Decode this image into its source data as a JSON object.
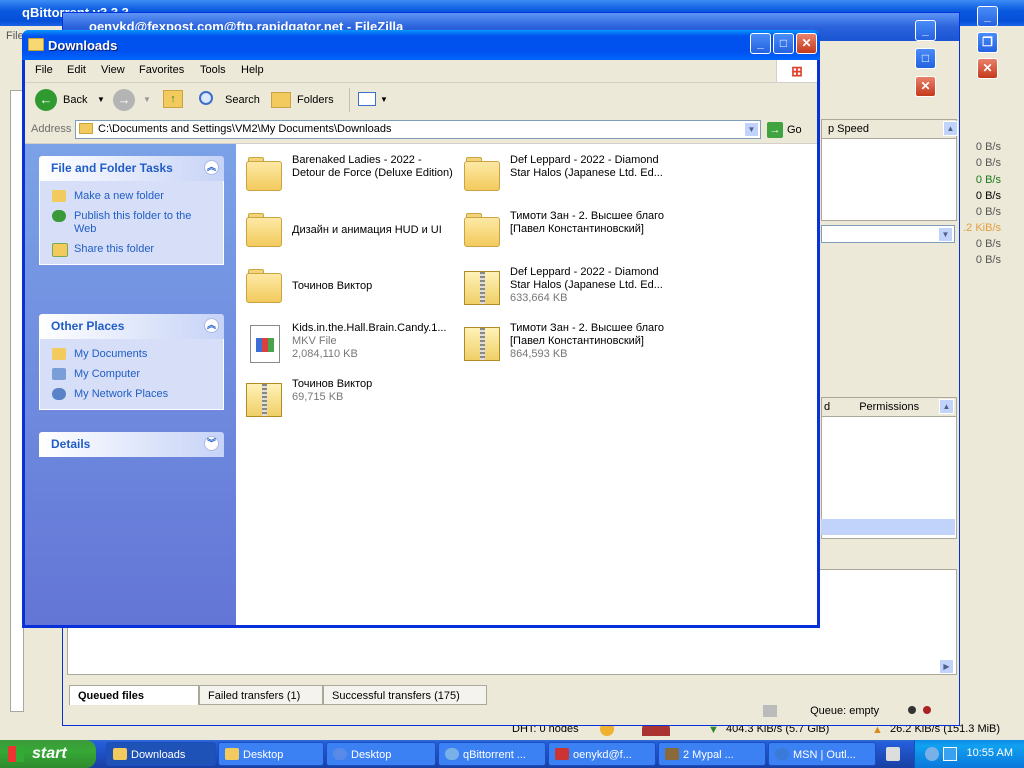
{
  "background_windows": {
    "qbittorrent_title": "qBittorrent v3.3.3",
    "qbittorrent_menu": "File",
    "filezilla_title": "oenykd@fexpost.com@ftp.rapidgator.net - FileZilla",
    "speed_column": "p Speed",
    "speeds": [
      "0 B/s",
      "0 B/s",
      "0 B/s",
      "0 B/s",
      "0 B/s",
      ".2 KiB/s",
      "0 B/s",
      "0 B/s"
    ],
    "permissions_header": "Permissions",
    "col_d": "d",
    "tabs": [
      "Queued files",
      "Failed transfers (1)",
      "Successful transfers (175)"
    ],
    "queue_status": "Queue: empty",
    "qbit_status": {
      "dht": "DHT: 0 nodes",
      "down": "404.3 KiB/s (5.7 GiB)",
      "up": "26.2 KiB/s (151.3 MiB)"
    }
  },
  "explorer": {
    "title": "Downloads",
    "menu": [
      "File",
      "Edit",
      "View",
      "Favorites",
      "Tools",
      "Help"
    ],
    "toolbar": {
      "back": "Back",
      "search": "Search",
      "folders": "Folders"
    },
    "address_label": "Address",
    "address_value": "C:\\Documents and Settings\\VM2\\My Documents\\Downloads",
    "go_label": "Go",
    "left_pane": {
      "file_tasks_title": "File and Folder Tasks",
      "file_tasks": [
        "Make a new folder",
        "Publish this folder to the Web",
        "Share this folder"
      ],
      "other_places_title": "Other Places",
      "other_places": [
        "My Documents",
        "My Computer",
        "My Network Places"
      ],
      "details_title": "Details"
    },
    "items": [
      {
        "name": "Barenaked Ladies - 2022 - Detour de Force (Deluxe Edition)",
        "type": "folder",
        "sub1": "",
        "sub2": ""
      },
      {
        "name": "Def Leppard - 2022 - Diamond Star Halos (Japanese Ltd. Ed...",
        "type": "folder",
        "sub1": "",
        "sub2": ""
      },
      {
        "name": "Дизайн и анимация HUD и UI",
        "type": "folder",
        "sub1": "",
        "sub2": ""
      },
      {
        "name": "Тимоти Зан - 2. Высшее благо [Павел Константиновский]",
        "type": "folder",
        "sub1": "",
        "sub2": ""
      },
      {
        "name": "Точинов Виктор",
        "type": "folder",
        "sub1": "",
        "sub2": ""
      },
      {
        "name": "Def Leppard - 2022 - Diamond Star Halos (Japanese Ltd. Ed...",
        "type": "zip",
        "sub1": "633,664 KB",
        "sub2": ""
      },
      {
        "name": "Kids.in.the.Hall.Brain.Candy.1...",
        "type": "mkv",
        "sub1": "MKV File",
        "sub2": "2,084,110 KB"
      },
      {
        "name": "Тимоти Зан - 2. Высшее благо [Павел Константиновский]",
        "type": "zip",
        "sub1": "864,593 KB",
        "sub2": ""
      },
      {
        "name": "Точинов Виктор",
        "type": "zip",
        "sub1": "69,715 KB",
        "sub2": ""
      }
    ]
  },
  "taskbar": {
    "start": "start",
    "buttons": [
      "Downloads",
      "Desktop",
      "Desktop",
      "qBittorrent ...",
      "oenykd@f...",
      "2 Mypal ...",
      "MSN | Outl..."
    ],
    "clock": "10:55 AM"
  },
  "colors": {
    "xp_blue": "#0054e3",
    "task_link": "#215dc6",
    "start_green": "#37a836"
  }
}
